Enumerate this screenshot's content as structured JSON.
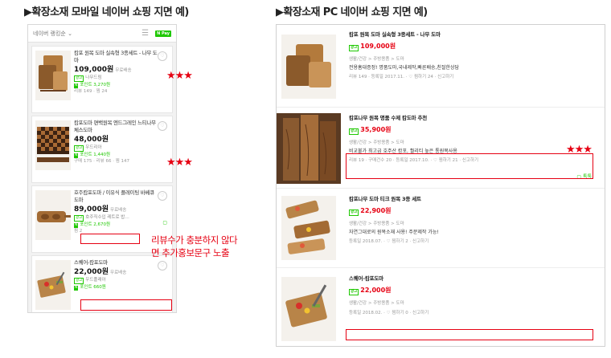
{
  "titles": {
    "mobile": "▶확장소재 모바일 네이버 쇼핑 지면 예)",
    "pc": "▶확장소재 PC 네이버 쇼핑 지면 예)"
  },
  "mobile": {
    "sort_label": "네이버 랭킹순",
    "sort_icon": "chevron-down-icon",
    "view_icon": "list-icon",
    "npay_label": "N Pay",
    "items": [
      {
        "name": "캄포 원목 도마 실속형 3종세트 - 나무 도마",
        "price": "109,000원",
        "ship": "무료배송",
        "ad": "광고",
        "store": "나무드림",
        "point": "포인트 3,270원",
        "meta": "리뷰 149 · 찜 24",
        "rating_mark": "★★★"
      },
      {
        "name": "캄포도마 편백원목 엔드그레인 느티나무 체스도마",
        "price": "48,000원",
        "ship": "",
        "ad": "광고",
        "store": "우드리아",
        "point": "포인트 1,440원",
        "meta": "구매 175 · 리뷰 66 · 찜 147",
        "rating_mark": "★★★"
      },
      {
        "name": "호주캄포도마 / 이유식 플레이팅 바베큐 도마",
        "price": "89,000원",
        "ship": "무료배송",
        "ad": "광고",
        "store": "호주직수입 레트로 밥…",
        "point": "포인트 2,670원",
        "meta": "찜 2",
        "rating_mark": ""
      },
      {
        "name": "스퀘어-캄포도마",
        "price": "22,000원",
        "ship": "무료배송",
        "ad": "광고",
        "store": "우드플레아",
        "point": "포인트 660원",
        "meta": "",
        "rating_mark": ""
      }
    ],
    "annotation_line1": "리뷰수가 충분하지 않다",
    "annotation_line2": "면 추가홍보문구 노출"
  },
  "pc": {
    "items": [
      {
        "name": "캄포 원목 도마 실속형 3종세트 - 나무 도마",
        "ad": "광고",
        "price": "109,000원",
        "category": "생활/건강 > 주방용품 > 도마",
        "desc": "전용홈대증정! 명품도마,국내제작,빠른배송,친절한상담",
        "meta": "리뷰 149 · 등록일 2017.11. · ♡ 찜하기 24 · 신고하기",
        "chat": ""
      },
      {
        "name": "캄포나무 원목 명품 수제 캄도마 추천",
        "ad": "광고",
        "price": "35,900원",
        "category": "생활/건강 > 주방용품 > 도마",
        "desc": "비교불가 최고급 호주산 캄포, 퀄리티 높은 통원목사용",
        "meta": "리뷰 19 · 구매건수 20 · 등록일 2017.10. · ♡ 찜하기 21 · 신고하기",
        "chat": "톡톡",
        "rating_mark": "★★★"
      },
      {
        "name": "캄포나무 도마 티크 원목 3종 세트",
        "ad": "광고",
        "price": "22,900원",
        "category": "생활/건강 > 주방용품 > 도마",
        "desc": "자연그대로의 원목소재 사용! 주문제작 가능!",
        "meta": "등록일 2018.07. · ♡ 찜하기 2 · 신고하기",
        "chat": ""
      },
      {
        "name": "스퀘어-캄포도마",
        "ad": "광고",
        "price": "22,000원",
        "category": "생활/건강 > 주방용품 > 도마",
        "desc": "",
        "meta": "등록일 2018.02. · ♡ 찜하기 0 · 신고하기",
        "chat": ""
      }
    ]
  },
  "colors": {
    "naver_green": "#1ec800",
    "highlight_red": "#e60012",
    "price_red": "#e60012"
  }
}
